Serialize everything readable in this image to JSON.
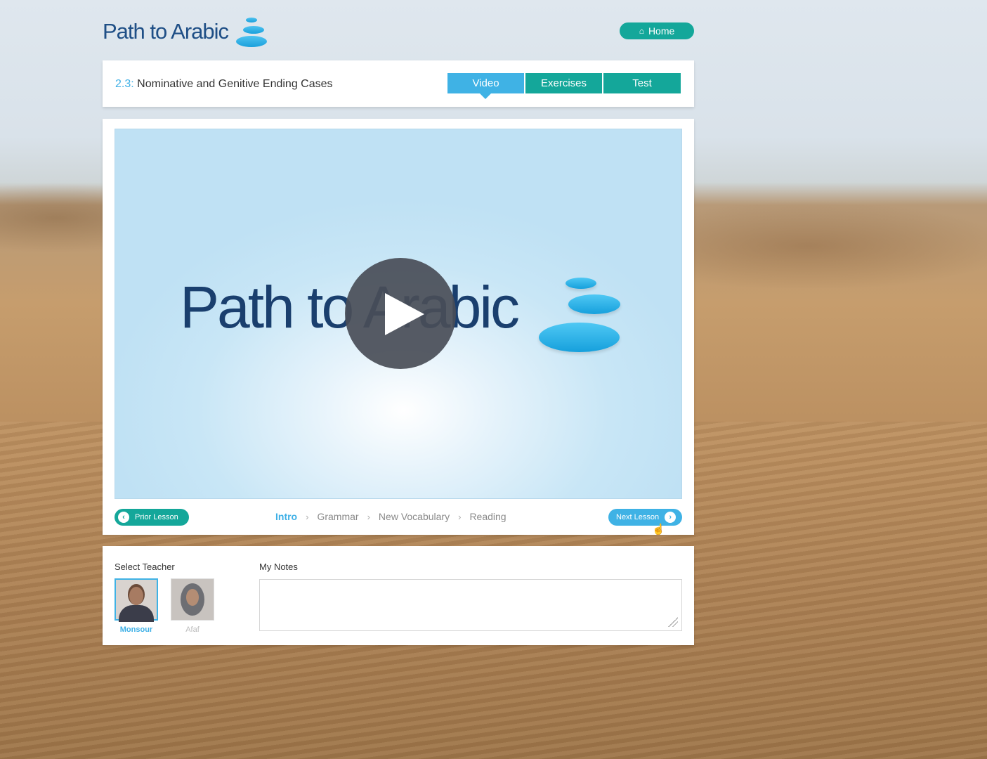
{
  "brand": {
    "name": "Path to Arabic"
  },
  "nav": {
    "home_label": "Home",
    "home_icon": "home-icon"
  },
  "lesson": {
    "number": "2.3:",
    "title": "Nominative and Genitive Ending Cases"
  },
  "tabs": [
    {
      "label": "Video",
      "active": true
    },
    {
      "label": "Exercises",
      "active": false
    },
    {
      "label": "Test",
      "active": false
    }
  ],
  "video": {
    "logo_text": "Path to Arabic",
    "play_icon": "play-icon"
  },
  "lesson_nav": {
    "prior_label": "Prior Lesson",
    "next_label": "Next Lesson",
    "steps": [
      {
        "label": "Intro",
        "active": true
      },
      {
        "label": "Grammar",
        "active": false
      },
      {
        "label": "New Vocabulary",
        "active": false
      },
      {
        "label": "Reading",
        "active": false
      }
    ]
  },
  "teachers": {
    "label": "Select Teacher",
    "items": [
      {
        "name": "Monsour",
        "selected": true
      },
      {
        "name": "Afaf",
        "selected": false
      }
    ]
  },
  "notes": {
    "label": "My Notes",
    "value": ""
  },
  "colors": {
    "blue": "#3fb2e5",
    "teal": "#14a79a",
    "navy": "#1f4f86"
  }
}
